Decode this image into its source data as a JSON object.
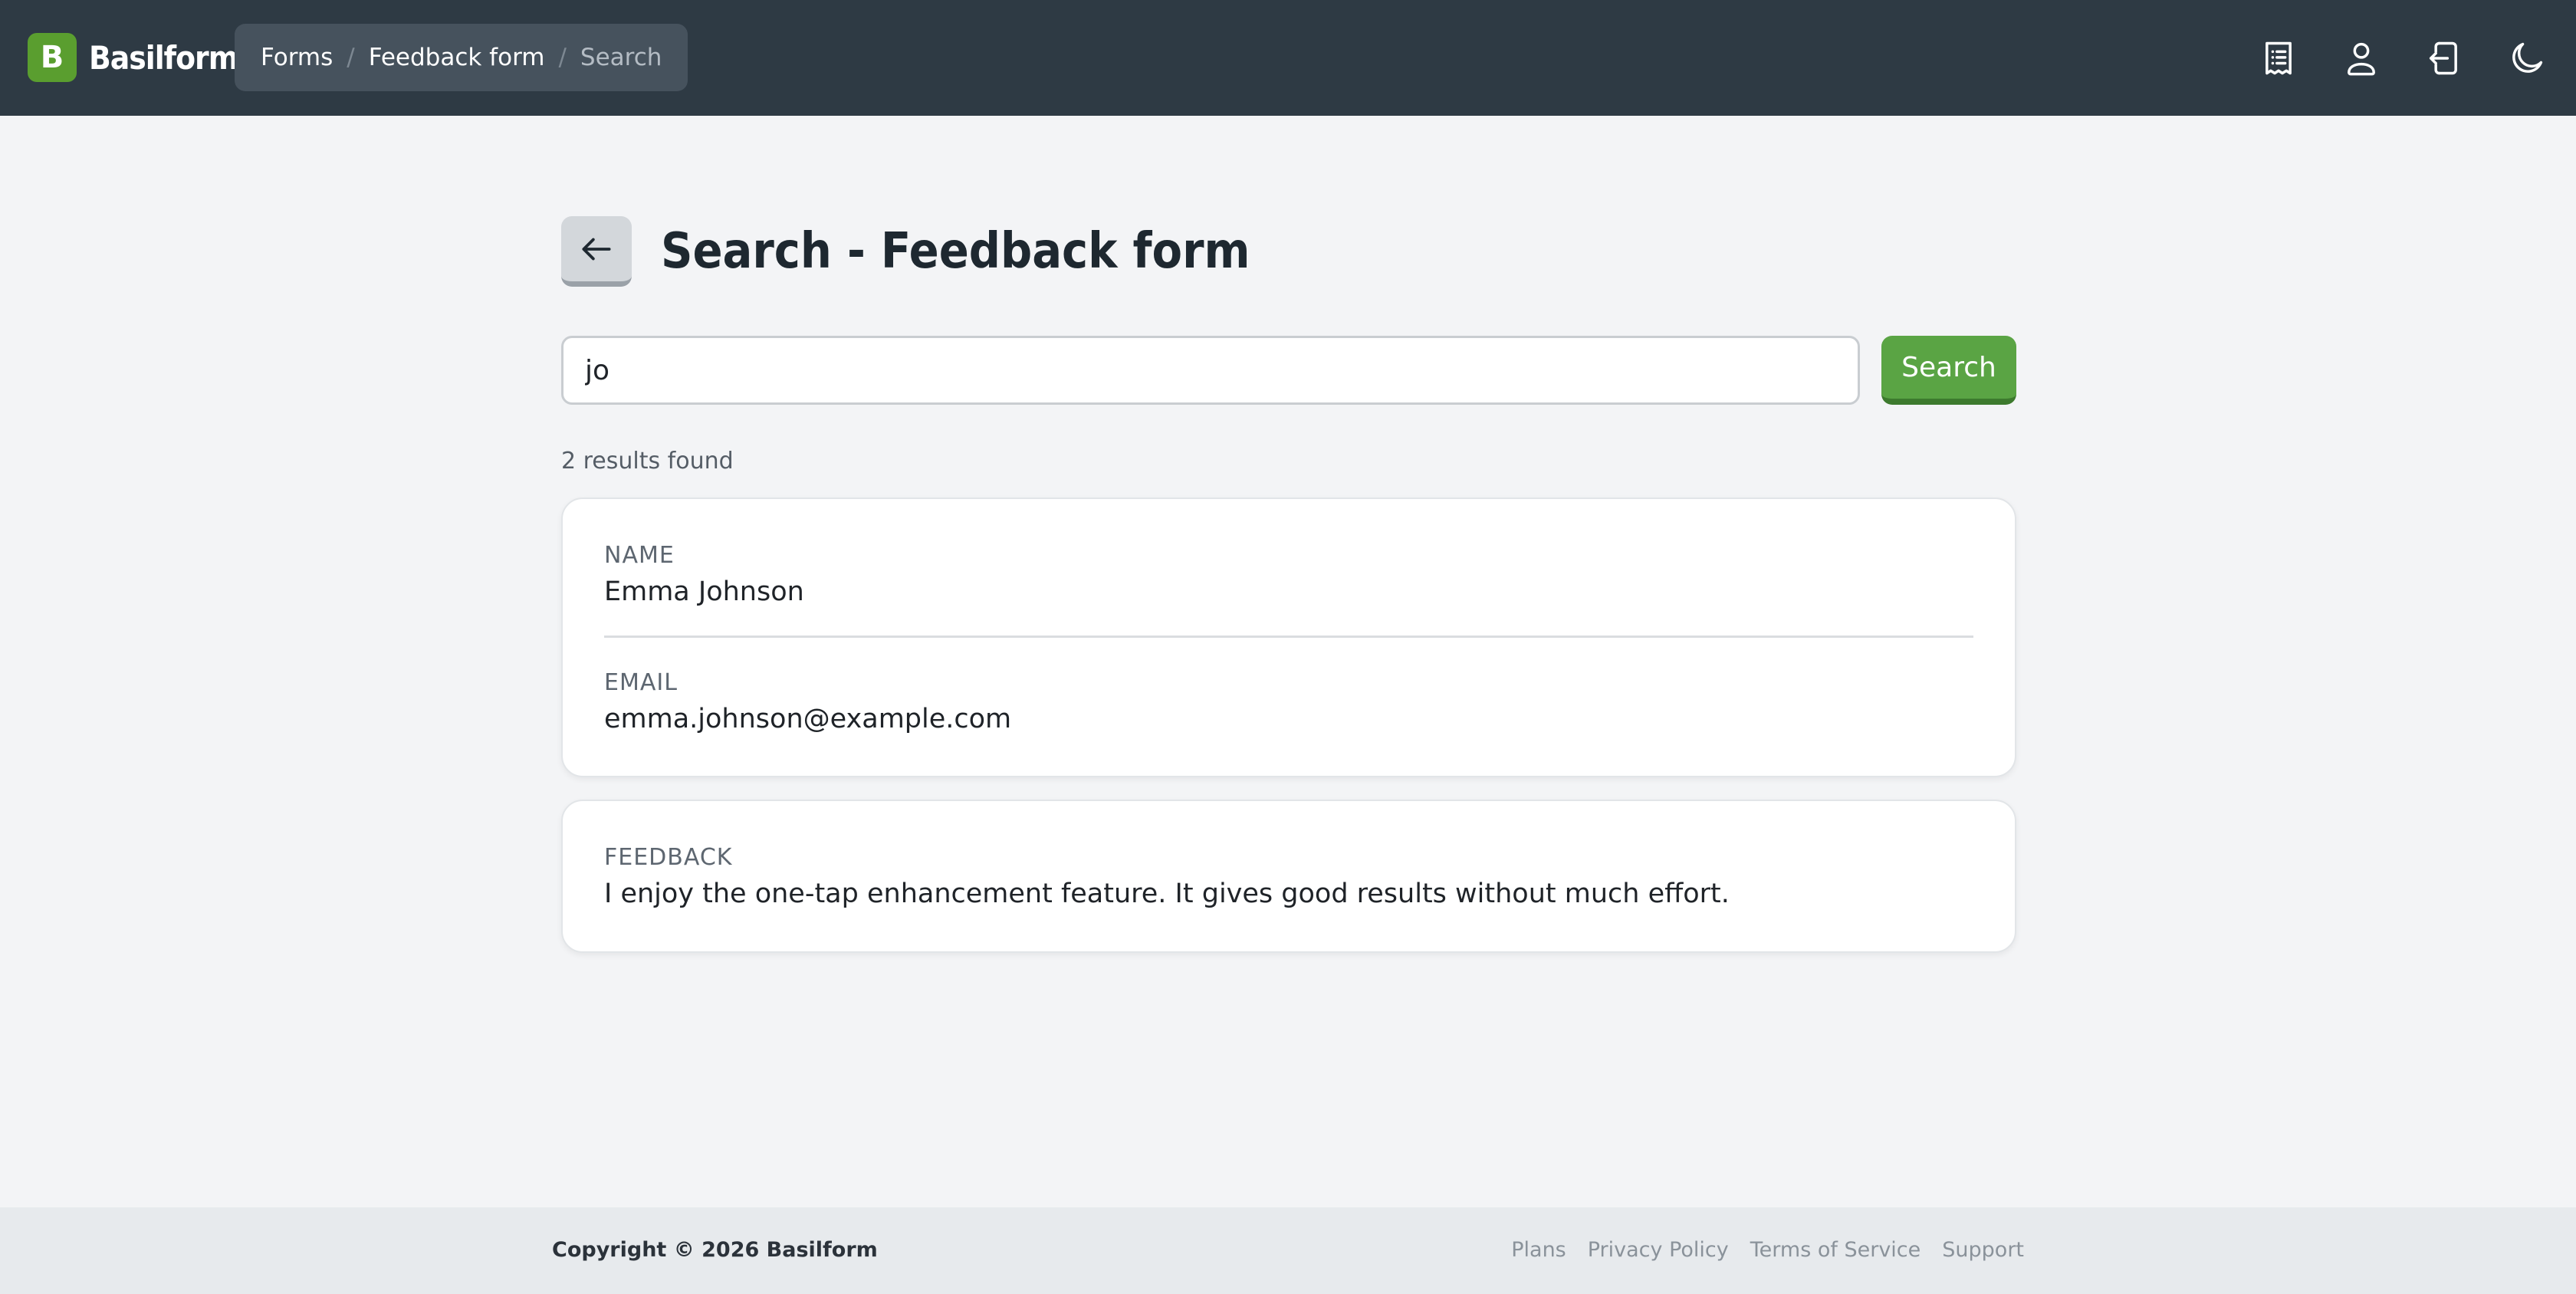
{
  "app": {
    "logo_letter": "B",
    "name": "Basilform"
  },
  "breadcrumb": {
    "items": [
      "Forms",
      "Feedback form"
    ],
    "separator": "/",
    "current": "Search"
  },
  "header_icons": [
    "receipt-list-icon",
    "user-icon",
    "logout-icon",
    "moon-icon"
  ],
  "page": {
    "title": "Search - Feedback form"
  },
  "search": {
    "value": "jo",
    "button_label": "Search",
    "result_count": "2 results found"
  },
  "results": [
    {
      "fields": [
        {
          "label": "NAME",
          "value": "Emma Johnson"
        },
        {
          "label": "EMAIL",
          "value": "emma.johnson@example.com"
        }
      ]
    },
    {
      "fields": [
        {
          "label": "FEEDBACK",
          "value": "I enjoy the one-tap enhancement feature. It gives good results without much effort."
        }
      ]
    }
  ],
  "footer": {
    "copyright": "Copyright © 2026 Basilform",
    "links": [
      "Plans",
      "Privacy Policy",
      "Terms of Service",
      "Support"
    ]
  },
  "colors": {
    "topbar": "#2e3a44",
    "accent_green": "#5aa444",
    "logo_green": "#5a9e2f",
    "background": "#f3f4f6"
  }
}
